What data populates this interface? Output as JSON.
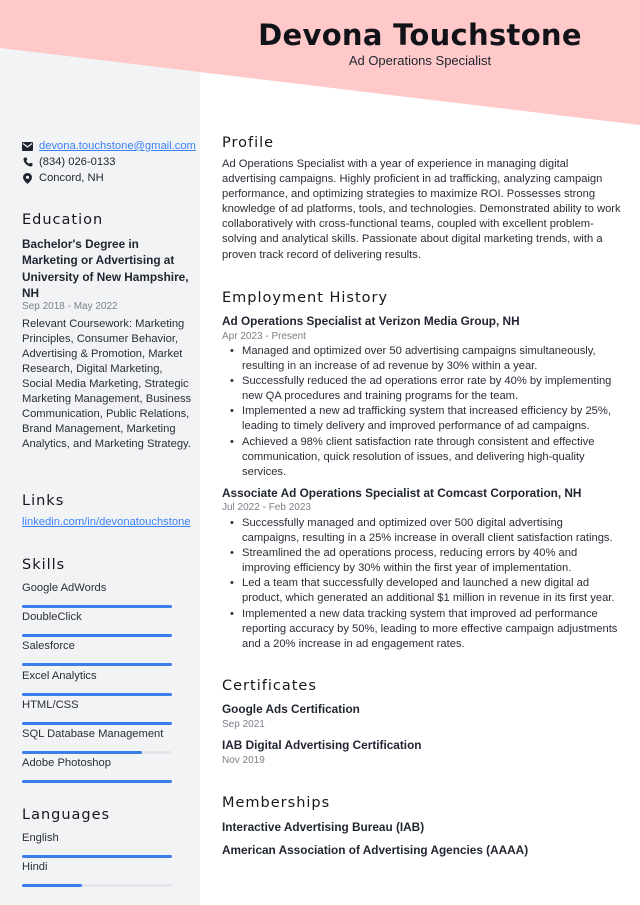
{
  "header": {
    "name": "Devona Touchstone",
    "title": "Ad Operations Specialist",
    "accent_color": "#ffc9c9"
  },
  "contact": {
    "email": "devona.touchstone@gmail.com",
    "phone": "(834) 026-0133",
    "location": "Concord, NH",
    "icons": [
      "envelope-icon",
      "phone-icon",
      "map-pin-icon"
    ]
  },
  "education": {
    "heading": "Education",
    "degree": "Bachelor's Degree in Marketing or Advertising at University of New Hampshire, NH",
    "dates": "Sep 2018 - May 2022",
    "coursework": "Relevant Coursework: Marketing Principles, Consumer Behavior, Advertising & Promotion, Market Research, Digital Marketing, Social Media Marketing, Strategic Marketing Management, Business Communication, Public Relations, Brand Management, Marketing Analytics, and Marketing Strategy."
  },
  "links": {
    "heading": "Links",
    "items": [
      "linkedin.com/in/devonatouchstone"
    ]
  },
  "skills": {
    "heading": "Skills",
    "bar_color": "#3b7ded",
    "items": [
      {
        "label": "Google AdWords",
        "level": 1.0
      },
      {
        "label": "DoubleClick",
        "level": 1.0
      },
      {
        "label": "Salesforce",
        "level": 1.0
      },
      {
        "label": "Excel Analytics",
        "level": 1.0
      },
      {
        "label": "HTML/CSS",
        "level": 1.0
      },
      {
        "label": "SQL Database Management",
        "level": 0.8
      },
      {
        "label": "Adobe Photoshop",
        "level": 1.0
      }
    ]
  },
  "languages": {
    "heading": "Languages",
    "items": [
      {
        "label": "English",
        "level": 1.0
      },
      {
        "label": "Hindi",
        "level": 0.4
      }
    ]
  },
  "profile": {
    "heading": "Profile",
    "text": "Ad Operations Specialist with a year of experience in managing digital advertising campaigns. Highly proficient in ad trafficking, analyzing campaign performance, and optimizing strategies to maximize ROI. Possesses strong knowledge of ad platforms, tools, and technologies. Demonstrated ability to work collaboratively with cross-functional teams, coupled with excellent problem-solving and analytical skills. Passionate about digital marketing trends, with a proven track record of delivering results."
  },
  "employment": {
    "heading": "Employment History",
    "jobs": [
      {
        "title": "Ad Operations Specialist at Verizon Media Group, NH",
        "dates": "Apr 2023 - Present",
        "bullets": [
          "Managed and optimized over 50 advertising campaigns simultaneously, resulting in an increase of ad revenue by 30% within a year.",
          "Successfully reduced the ad operations error rate by 40% by implementing new QA procedures and training programs for the team.",
          "Implemented a new ad trafficking system that increased efficiency by 25%, leading to timely delivery and improved performance of ad campaigns.",
          "Achieved a 98% client satisfaction rate through consistent and effective communication, quick resolution of issues, and delivering high-quality services."
        ]
      },
      {
        "title": "Associate Ad Operations Specialist at Comcast Corporation, NH",
        "dates": "Jul 2022 - Feb 2023",
        "bullets": [
          "Successfully managed and optimized over 500 digital advertising campaigns, resulting in a 25% increase in overall client satisfaction ratings.",
          "Streamlined the ad operations process, reducing errors by 40% and improving efficiency by 30% within the first year of implementation.",
          "Led a team that successfully developed and launched a new digital ad product, which generated an additional $1 million in revenue in its first year.",
          "Implemented a new data tracking system that improved ad performance reporting accuracy by 50%, leading to more effective campaign adjustments and a 20% increase in ad engagement rates."
        ]
      }
    ]
  },
  "certificates": {
    "heading": "Certificates",
    "items": [
      {
        "title": "Google Ads Certification",
        "date": "Sep 2021"
      },
      {
        "title": "IAB Digital Advertising Certification",
        "date": "Nov 2019"
      }
    ]
  },
  "memberships": {
    "heading": "Memberships",
    "items": [
      "Interactive Advertising Bureau (IAB)",
      "American Association of Advertising Agencies (AAAA)"
    ]
  }
}
